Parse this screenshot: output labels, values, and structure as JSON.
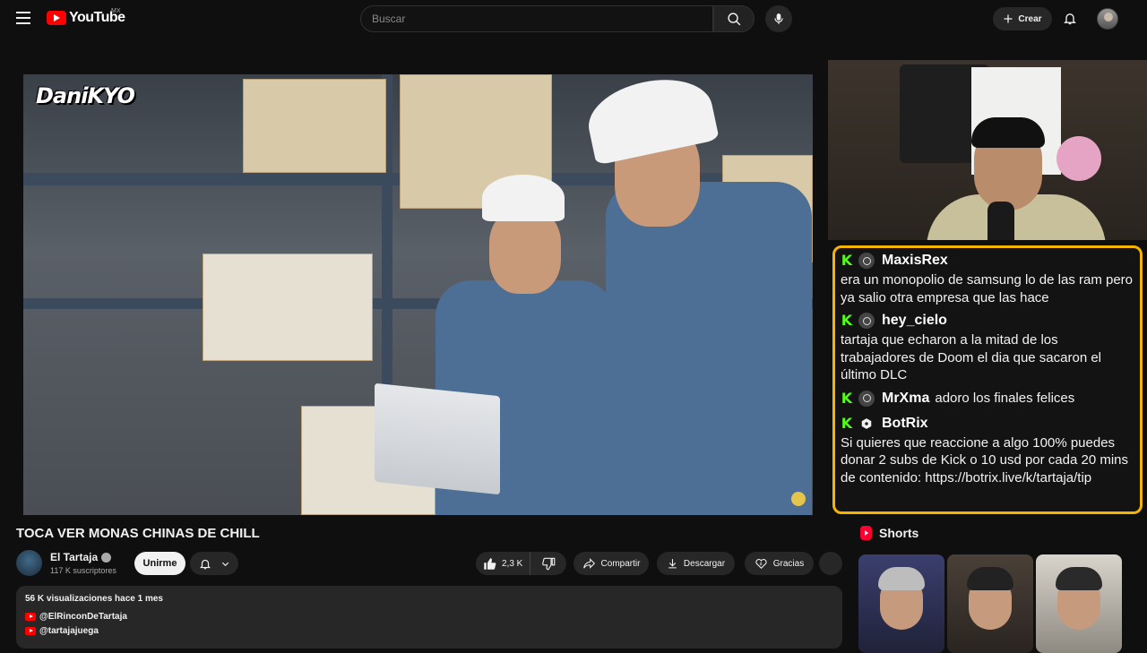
{
  "header": {
    "logo_text": "YouTube",
    "country": "MX",
    "search_placeholder": "Buscar",
    "create_label": "Crear"
  },
  "video": {
    "watermark": "DaniKYO",
    "title": "TOCA VER MONAS CHINAS DE CHILL"
  },
  "channel": {
    "name": "El Tartaja",
    "subscribers": "117 K suscriptores",
    "join_label": "Unirme"
  },
  "actions": {
    "likes": "2,3 K",
    "share": "Compartir",
    "download": "Descargar",
    "thanks": "Gracias"
  },
  "description": {
    "meta": "56 K visualizaciones  hace 1 mes",
    "links": [
      "@ElRinconDeTartaja",
      "@tartajajuega"
    ]
  },
  "chat": [
    {
      "user": "MaxisRex",
      "message": "era un monopolio de samsung lo de las ram pero ya salio otra empresa que las hace",
      "inline": false,
      "icon": "user-icon"
    },
    {
      "user": "hey_cielo",
      "message": "tartaja que echaron a la mitad de los trabajadores de Doom el dia que sacaron el último DLC",
      "inline": false,
      "icon": "user-icon"
    },
    {
      "user": "MrXma",
      "message": "adoro los finales felices",
      "inline": true,
      "icon": "user-icon"
    },
    {
      "user": "BotRix",
      "message": "Si quieres que reaccione a algo 100% puedes donar 2 subs de Kick o 10 usd por cada 20 mins de contenido: https://botrix.live/k/tartaja/tip",
      "inline": false,
      "icon": "bot-icon"
    }
  ],
  "shorts": {
    "heading": "Shorts"
  },
  "colors": {
    "brand_red": "#ff0000",
    "chat_border": "#f4b400",
    "kick_green": "#53fc18"
  }
}
